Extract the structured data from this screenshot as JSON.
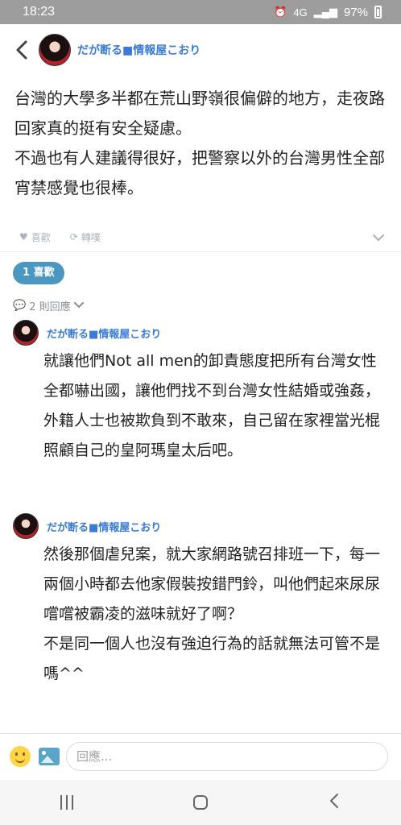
{
  "status": {
    "time": "18:23",
    "network": "4G",
    "battery": "97%"
  },
  "post": {
    "author": "だが断る■情報屋こおり",
    "body": [
      "台灣的大學多半都在荒山野嶺很偏僻的地方，走夜路回家真的挺有安全疑慮。",
      "不過也有人建議得很好，把警察以外的台灣男性全部宵禁感覺也很棒。"
    ],
    "like_label": "喜歡",
    "share_label": "轉噗",
    "likes_badge": "1 喜歡",
    "reply_count": "2 則回應"
  },
  "comments": [
    {
      "author": "だが断る■情報屋こおり",
      "paragraphs": [
        "就讓他們Not all men的卸責態度把所有台灣女性全都嚇出國，讓他們找不到台灣女性結婚或強姦，外籍人士也被欺負到不敢來，自己留在家裡當光棍照顧自己的皇阿瑪皇太后吧。"
      ]
    },
    {
      "author": "だが断る■情報屋こおり",
      "paragraphs": [
        "然後那個虐兒案，就大家網路號召排班一下，每一兩個小時都去他家假裝按錯門鈴，叫他們起來尿尿嚐嚐被霸凌的滋味就好了啊？",
        "不是同一個人也沒有強迫行為的話就無法可管不是嗎^^"
      ]
    }
  ],
  "reply_bar": {
    "placeholder": "回應..."
  },
  "colors": {
    "author": "#3a7bd5",
    "badge": "#4a98c1",
    "statusbar": "#9d9d9d"
  }
}
